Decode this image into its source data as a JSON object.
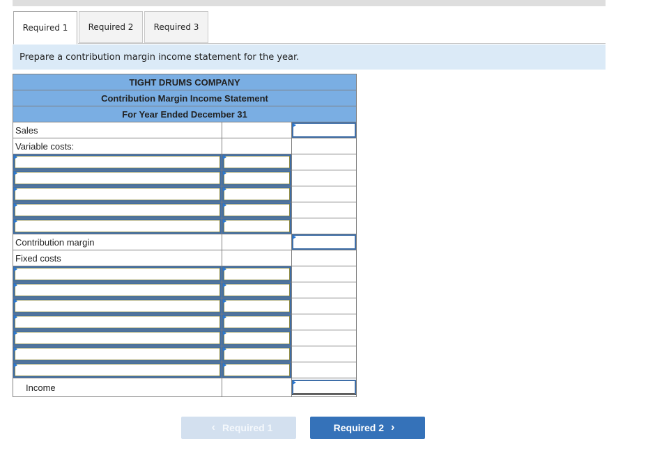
{
  "tabs": [
    {
      "label": "Required 1",
      "active": true
    },
    {
      "label": "Required 2",
      "active": false
    },
    {
      "label": "Required 3",
      "active": false
    }
  ],
  "instruction": "Prepare a contribution margin income statement for the year.",
  "statement": {
    "company": "TIGHT DRUMS COMPANY",
    "title": "Contribution Margin Income Statement",
    "period": "For Year Ended December 31",
    "sales_label": "Sales",
    "variable_costs_label": "Variable costs:",
    "contribution_margin_label": "Contribution margin",
    "fixed_costs_label": "Fixed costs",
    "income_label": "Income",
    "sales_value": "",
    "contribution_margin_value": "",
    "income_value": "",
    "variable_rows": [
      {
        "label": "",
        "amount": ""
      },
      {
        "label": "",
        "amount": ""
      },
      {
        "label": "",
        "amount": ""
      },
      {
        "label": "",
        "amount": ""
      },
      {
        "label": "",
        "amount": ""
      }
    ],
    "fixed_rows": [
      {
        "label": "",
        "amount": ""
      },
      {
        "label": "",
        "amount": ""
      },
      {
        "label": "",
        "amount": ""
      },
      {
        "label": "",
        "amount": ""
      },
      {
        "label": "",
        "amount": ""
      },
      {
        "label": "",
        "amount": ""
      },
      {
        "label": "",
        "amount": ""
      }
    ]
  },
  "nav": {
    "prev_label": "Required 1",
    "next_label": "Required 2",
    "prev_icon": "chevron-left-icon",
    "next_icon": "chevron-right-icon",
    "prev_glyph": "‹",
    "next_glyph": "›"
  }
}
